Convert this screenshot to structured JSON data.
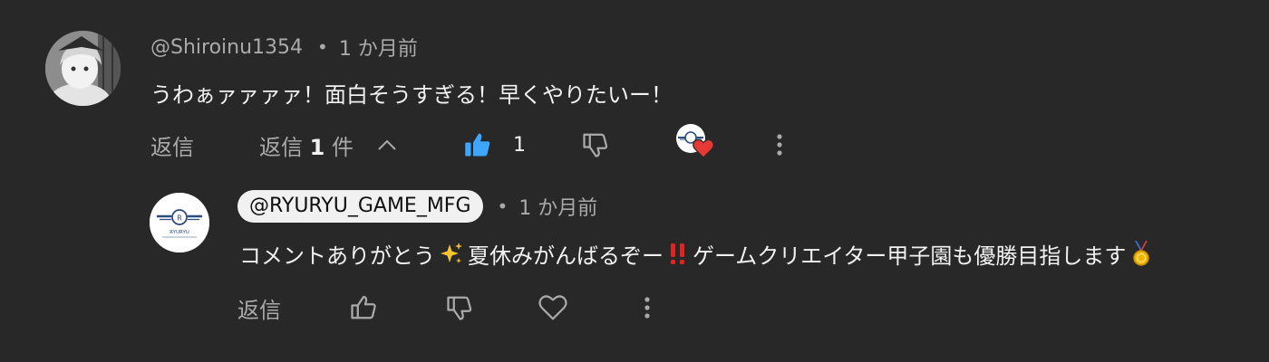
{
  "comment": {
    "author": "@Shiroinu1354",
    "separator": "•",
    "time": "1 か月前",
    "text": "うわぁァァァァ！面白そうすぎる！早くやりたいー！",
    "reply_label": "返信",
    "replies_toggle": {
      "prefix": "返信 ",
      "count": "1",
      "suffix": " 件"
    },
    "like_count": "1",
    "liked": true,
    "creator_heart": true
  },
  "reply": {
    "author": "@RYURYU_GAME_MFG",
    "separator": "•",
    "time": "1 か月前",
    "text_part1": "コメントありがとう",
    "text_part2": "夏休みがんばるぞー",
    "text_part3": "ゲームクリエイター甲子園も優勝目指します",
    "reply_label": "返信",
    "channel_logo_text": "RYURYU"
  },
  "colors": {
    "background": "#282828",
    "text_primary": "#f1f1f1",
    "text_secondary": "#aaaaaa",
    "like_active": "#3ea6ff",
    "heart": "#e53935"
  },
  "icons": {
    "like": "thumbs-up-icon",
    "dislike": "thumbs-down-icon",
    "heart": "heart-icon",
    "menu": "more-vert-icon",
    "toggle": "chevron-up-icon"
  }
}
